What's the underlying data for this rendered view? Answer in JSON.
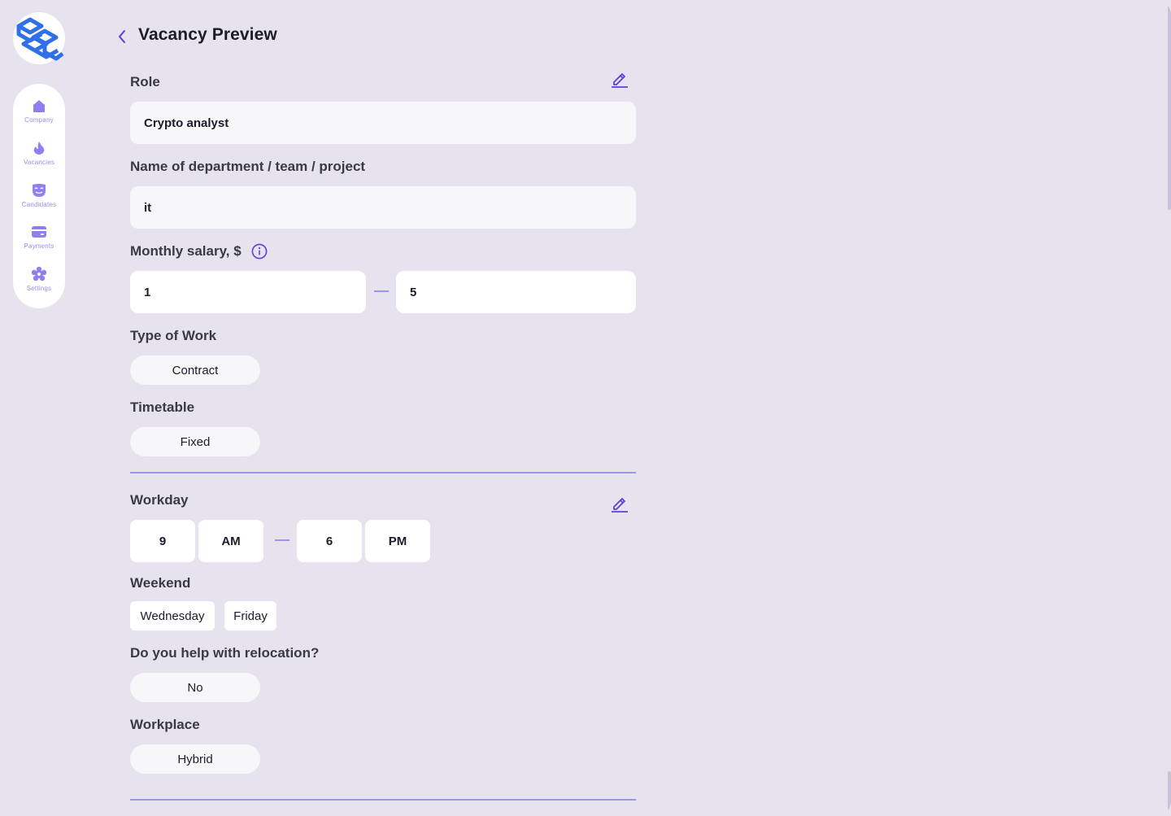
{
  "header": {
    "title": "Vacancy Preview"
  },
  "sidebar": {
    "items": [
      {
        "label": "Company",
        "icon": "home-icon"
      },
      {
        "label": "Vacancies",
        "icon": "flame-icon"
      },
      {
        "label": "Candidates",
        "icon": "mask-icon"
      },
      {
        "label": "Payments",
        "icon": "card-icon"
      },
      {
        "label": "Settings",
        "icon": "gear-icon"
      }
    ]
  },
  "form": {
    "role_label": "Role",
    "role_value": "Crypto analyst",
    "department_label": "Name of department / team / project",
    "department_value": "it",
    "salary_label": "Monthly salary, $",
    "salary_min": "1",
    "salary_max": "5",
    "work_type_label": "Type of Work",
    "work_type_value": "Contract",
    "timetable_label": "Timetable",
    "timetable_value": "Fixed",
    "workday_label": "Workday",
    "workday_start_hour": "9",
    "workday_start_period": "AM",
    "workday_end_hour": "6",
    "workday_end_period": "PM",
    "weekend_label": "Weekend",
    "weekend_days": [
      "Wednesday",
      "Friday"
    ],
    "relocation_label": "Do you help with relocation?",
    "relocation_value": "No",
    "workplace_label": "Workplace",
    "workplace_value": "Hybrid"
  },
  "colors": {
    "accent": "#5b3fd6",
    "accent_light": "#9f94ec",
    "background": "#e6e3ef",
    "logo_blue": "#2f6fe8"
  }
}
